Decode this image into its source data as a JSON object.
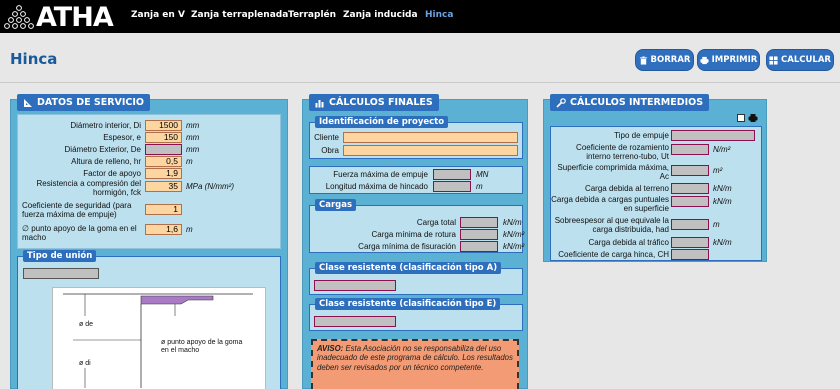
{
  "nav": {
    "logo_text": "ATHA",
    "items": [
      "Zanja en V",
      "Zanja terraplenada",
      "Terraplén",
      "Zanja inducida",
      "Hinca"
    ],
    "active_index": 4
  },
  "header": {
    "title": "Hinca",
    "buttons": {
      "borrar": "BORRAR",
      "imprimir": "IMPRIMIR",
      "calcular": "CALCULAR"
    }
  },
  "datos": {
    "title": "DATOS DE SERVICIO",
    "fields": [
      {
        "label": "Diámetro interior, Di",
        "value": "1500",
        "unit": "mm"
      },
      {
        "label": "Espesor, e",
        "value": "150",
        "unit": "mm"
      },
      {
        "label": "Diámetro Exterior, De",
        "value": "",
        "unit": "mm"
      },
      {
        "label": "Altura de relleno, hr",
        "value": "0,5",
        "unit": "m"
      },
      {
        "label": "Factor de apoyo",
        "value": "1,9",
        "unit": ""
      },
      {
        "label": "Resistencia a compresión del hormigón, fck",
        "value": "35",
        "unit": "MPa (N/mm²)"
      },
      {
        "label": "Coeficiente de seguridad (para fuerza máxima de empuje)",
        "value": "1",
        "unit": ""
      },
      {
        "label": "∅ punto apoyo de la goma en el macho",
        "value": "1,6",
        "unit": "m"
      }
    ],
    "tipo_union": {
      "title": "Tipo de unión",
      "selected": "",
      "diagram_labels": {
        "de": "ø de",
        "di": "ø di",
        "goma": "ø punto apoyo de la goma en el macho"
      }
    }
  },
  "finales": {
    "title": "CÁLCULOS FINALES",
    "identificacion": {
      "title": "Identificación de proyecto",
      "cliente_label": "Cliente",
      "cliente": "",
      "obra_label": "Obra",
      "obra": ""
    },
    "fuerzas": [
      {
        "label": "Fuerza máxima de empuje",
        "unit": "MN"
      },
      {
        "label": "Longitud máxima de hincado",
        "unit": "m"
      }
    ],
    "cargas": {
      "title": "Cargas",
      "rows": [
        {
          "label": "Carga total",
          "unit": "kN/m"
        },
        {
          "label": "Carga mínima de rotura",
          "unit": "kN/m²"
        },
        {
          "label": "Carga mínima de fisuración",
          "unit": "kN/m²"
        }
      ]
    },
    "clase_a": "Clase resistente (clasificación tipo A)",
    "clase_e": "Clase resistente (clasificación tipo E)",
    "aviso_bold": "AVISO:",
    "aviso_text": " Esta Asociación no se responsabiliza del uso inadecuado de este programa de cálculo. Los resultados deben ser revisados por un técnico competente."
  },
  "intermedios": {
    "title": "CÁLCULOS INTERMEDIOS",
    "rows": [
      {
        "label": "Tipo de empuje",
        "unit": ""
      },
      {
        "label": "Coeficiente de rozamiento interno terreno-tubo, Ut",
        "unit": "N/m²"
      },
      {
        "label": "Superficie comprimida máxima, Ac",
        "unit": "m²"
      },
      {
        "label": "Carga debida al terreno",
        "unit": "kN/m"
      },
      {
        "label": "Carga debida a cargas puntuales en superficie",
        "unit": "kN/m"
      },
      {
        "label": "Sobreespesor al que equivale la carga distribuida, had",
        "unit": "m"
      },
      {
        "label": "Carga debida al tráfico",
        "unit": "kN/m"
      },
      {
        "label": "Coeficiente de carga hinca, CH",
        "unit": ""
      }
    ]
  },
  "colors": {
    "nav_bg": "#000000",
    "panel": "#5ab1d3",
    "title_bar": "#2e6fbd",
    "input": "#fcd5a0",
    "aviso": "#f39b74"
  }
}
